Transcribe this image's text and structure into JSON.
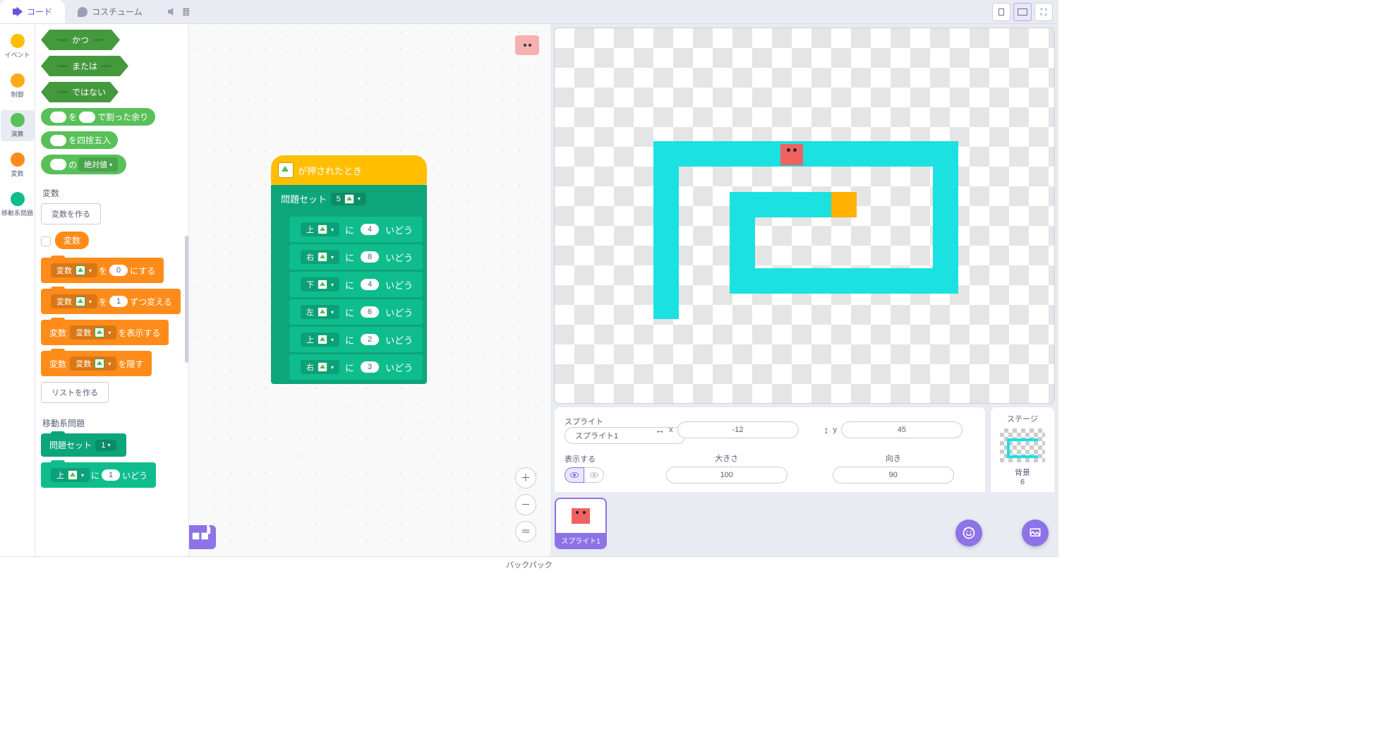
{
  "tabs": {
    "code": "コード",
    "costumes": "コスチューム",
    "sounds": "音"
  },
  "categories": [
    {
      "label": "イベント",
      "color": "#ffbf00"
    },
    {
      "label": "制御",
      "color": "#ffab19"
    },
    {
      "label": "演算",
      "color": "#59c059",
      "selected": true
    },
    {
      "label": "変数",
      "color": "#ff8c1a"
    },
    {
      "label": "移動系問題",
      "color": "#0fbd8c"
    }
  ],
  "palette": {
    "op_and": "かつ",
    "op_or": "または",
    "op_not": "ではない",
    "op_mod_a": "を",
    "op_mod_b": "で割った余り",
    "op_round": "を四捨五入",
    "op_of_a": "の",
    "op_of_b": "絶対値",
    "section_vars": "変数",
    "make_var": "変数を作る",
    "var_name": "変数",
    "setvar_a": "変数",
    "setvar_b": "を",
    "setvar_c": "にする",
    "setvar_v": "0",
    "changevar_a": "変数",
    "changevar_b": "を",
    "changevar_c": "ずつ変える",
    "changevar_v": "1",
    "showvar_a": "変数",
    "showvar_b": "変数",
    "showvar_c": "を表示する",
    "hidevar_a": "変数",
    "hidevar_b": "変数",
    "hidevar_c": "を隠す",
    "make_list": "リストを作る",
    "section_move": "移動系問題",
    "probset": "問題セット",
    "probset_v": "1",
    "move_dir": "上",
    "move_a": "に",
    "move_v": "1",
    "move_b": "いどう"
  },
  "script": {
    "hat": "が押されたとき",
    "probset": "問題セット",
    "probset_v": "5",
    "steps": [
      {
        "dir": "上",
        "n": "4"
      },
      {
        "dir": "右",
        "n": "8"
      },
      {
        "dir": "下",
        "n": "4"
      },
      {
        "dir": "左",
        "n": "6"
      },
      {
        "dir": "上",
        "n": "2"
      },
      {
        "dir": "右",
        "n": "3"
      }
    ],
    "move_a": "に",
    "move_b": "いどう"
  },
  "spriteInfo": {
    "title": "スプライト",
    "name": "スプライト1",
    "x_label": "x",
    "x": "-12",
    "y_label": "y",
    "y": "45",
    "show": "表示する",
    "size_label": "大きさ",
    "size": "100",
    "dir_label": "向き",
    "dir": "90"
  },
  "stagePanel": {
    "title": "ステージ",
    "bg_label": "背景",
    "bg_count": "6"
  },
  "spriteCard": "スプライト1",
  "backpack": "バックパック"
}
